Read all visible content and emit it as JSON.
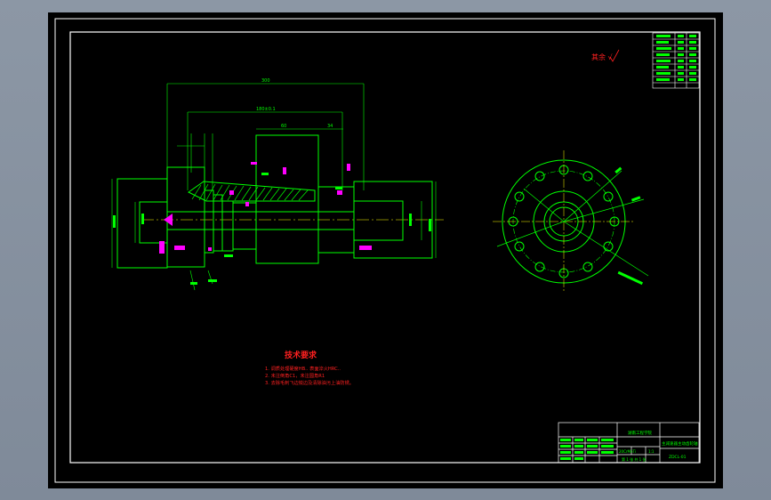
{
  "colors": {
    "background": "#000000",
    "frame": "#ffffff",
    "geometry": "#00ff00",
    "dimensions": "#00ff00",
    "notes": "#ff2020",
    "annotations": "#ff00ff",
    "centerline": "#ffff00",
    "hidden": "#00ffff"
  },
  "roughness_note": "其余 √",
  "tech_requirements": {
    "title": "技术要求",
    "items": [
      "1. 调质处理硬度HB.. 表面淬火HRC..",
      "2. 未注倒角C1，未注圆角R1",
      "3. 去除毛刺飞边锐边及清除油污上油防锈。"
    ]
  },
  "dimensions": {
    "overall_length": "300",
    "flange_span": "180±0.1",
    "body_length": "60",
    "hub_length": "34"
  },
  "title_block": {
    "company": "湖南工程学院",
    "part_name": "主减速器主动齿轮轴",
    "drawing_no": "ZDCL-01",
    "material": "20CrMnTi",
    "scale": "1:1",
    "sheet": "第 1 张  共 1 张"
  }
}
